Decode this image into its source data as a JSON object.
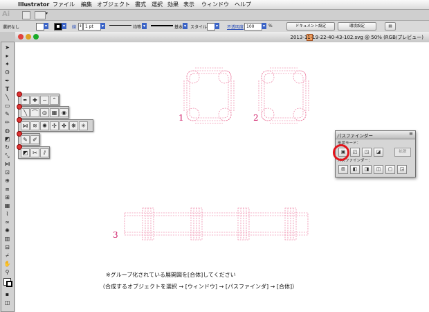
{
  "menubar": {
    "apple": "",
    "app": "Illustrator",
    "items": [
      "ファイル",
      "編集",
      "オブジェクト",
      "書式",
      "選択",
      "効果",
      "表示",
      "ウィンドウ",
      "ヘルプ"
    ]
  },
  "appbar": {
    "logo": "Ai"
  },
  "control": {
    "selection": "選択なし",
    "stroke_label": "線",
    "stroke_weight": "1 pt",
    "profile_label": "均等",
    "brush_label": "基本",
    "style_label": "スタイル",
    "opacity_label": "不透明度",
    "opacity_value": "100",
    "opacity_unit": "%",
    "doc_setup": "ドキュメント設定",
    "prefs": "環境設定"
  },
  "document": {
    "title": "2013-11-19-22-40-43-102.svg @ 50% (RGB/プレビュー)"
  },
  "canvas": {
    "labels": [
      "1",
      "2",
      "3"
    ],
    "note_line1": "※グループ化されている展開図を[合体]してください",
    "note_line2": "（合成するオブジェクトを選択 → [ウィンドウ] → [パスファインダ] → [合体]）"
  },
  "pathfinder": {
    "tab": "パスファインダー",
    "menu_icon": "menu-icon",
    "shape_modes_label": "形状モード：",
    "pathfinders_label": "パスファインダー：",
    "expand_label": "拡張"
  },
  "colors": {
    "accent_red": "#e2141c",
    "guide_pink": "#e9668f",
    "label_magenta": "#d0206a",
    "ui_blue": "#3a63c6"
  }
}
